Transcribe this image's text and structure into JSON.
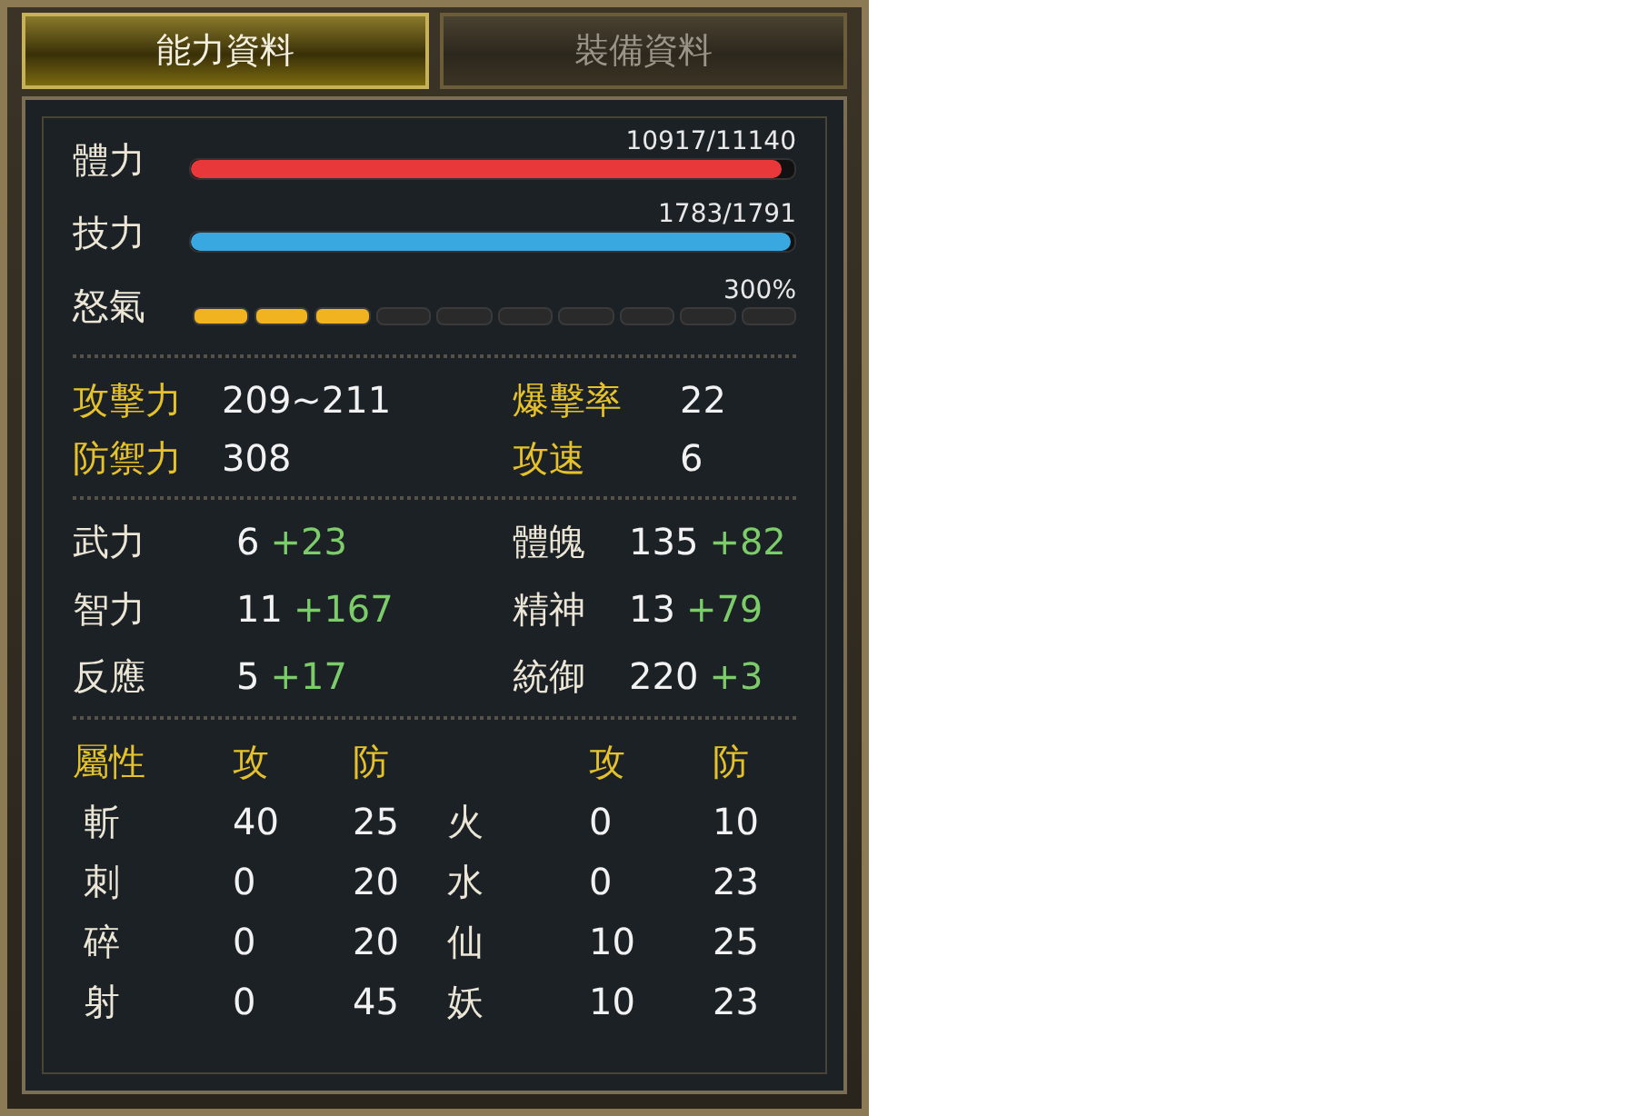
{
  "tabs": [
    {
      "label": "能力資料",
      "selected": true
    },
    {
      "label": "裝備資料",
      "selected": false
    }
  ],
  "gauges": [
    {
      "label": "體力",
      "reading": "10917/11140",
      "level": 0.98,
      "kind": "bar",
      "color": "#e8383a"
    },
    {
      "label": "技力",
      "reading": "1783/1791",
      "level": 0.995,
      "kind": "bar",
      "color": "#3aa8e0"
    },
    {
      "label": "怒氣",
      "reading": "300%",
      "level": 0.3,
      "kind": "segments",
      "color": "#f2b320"
    }
  ],
  "combat": [
    {
      "label": "攻擊力",
      "value": "209~211"
    },
    {
      "label": "爆擊率",
      "value": "22"
    },
    {
      "label": "防禦力",
      "value": "308"
    },
    {
      "label": "攻速",
      "value": "6"
    }
  ],
  "attributes": [
    {
      "label": "武力",
      "base": "6",
      "bonus": "+23"
    },
    {
      "label": "體魄",
      "base": "135",
      "bonus": "+82"
    },
    {
      "label": "智力",
      "base": "11",
      "bonus": "+167"
    },
    {
      "label": "精神",
      "base": "13",
      "bonus": "+79"
    },
    {
      "label": "反應",
      "base": "5",
      "bonus": "+17"
    },
    {
      "label": "統御",
      "base": "220",
      "bonus": "+3"
    }
  ],
  "elements": {
    "header": [
      "屬性",
      "攻",
      "防",
      "攻",
      "防"
    ],
    "rows": [
      [
        "斬",
        "40",
        "25",
        "火",
        "0",
        "10"
      ],
      [
        "刺",
        "0",
        "20",
        "水",
        "0",
        "23"
      ],
      [
        "碎",
        "0",
        "20",
        "仙",
        "10",
        "25"
      ],
      [
        "射",
        "0",
        "45",
        "妖",
        "10",
        "23"
      ]
    ]
  }
}
